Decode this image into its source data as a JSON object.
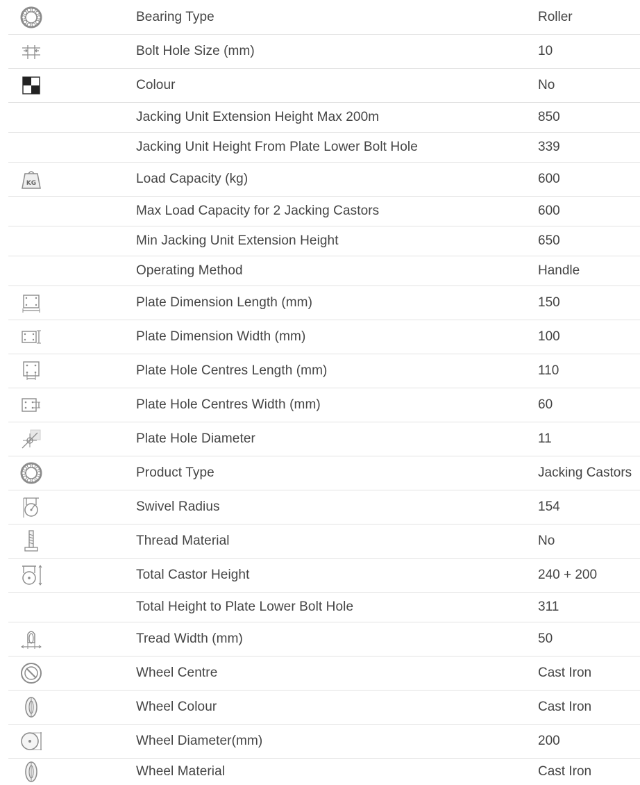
{
  "specs": [
    {
      "label": "Bearing Type",
      "value": "Roller",
      "icon": "bearing-icon"
    },
    {
      "label": "Bolt Hole Size (mm)",
      "value": "10",
      "icon": "bolt-hole-size-icon"
    },
    {
      "label": "Colour",
      "value": "No",
      "icon": "colour-icon"
    },
    {
      "label": "Jacking Unit Extension Height Max 200m",
      "value": "850",
      "icon": ""
    },
    {
      "label": "Jacking Unit Height From Plate Lower Bolt Hole",
      "value": "339",
      "icon": ""
    },
    {
      "label": "Load Capacity (kg)",
      "value": "600",
      "icon": "kg-weight-icon"
    },
    {
      "label": "Max Load Capacity for 2 Jacking Castors",
      "value": "600",
      "icon": ""
    },
    {
      "label": "Min Jacking Unit Extension Height",
      "value": "650",
      "icon": ""
    },
    {
      "label": "Operating Method",
      "value": "Handle",
      "icon": ""
    },
    {
      "label": "Plate Dimension Length (mm)",
      "value": "150",
      "icon": "plate-length-icon"
    },
    {
      "label": "Plate Dimension Width (mm)",
      "value": "100",
      "icon": "plate-width-icon"
    },
    {
      "label": "Plate Hole Centres Length (mm)",
      "value": "110",
      "icon": "plate-hole-centres-length-icon"
    },
    {
      "label": "Plate Hole Centres Width (mm)",
      "value": "60",
      "icon": "plate-hole-centres-width-icon"
    },
    {
      "label": "Plate Hole Diameter",
      "value": "11",
      "icon": "plate-hole-diameter-icon"
    },
    {
      "label": "Product Type",
      "value": "Jacking Castors",
      "icon": "product-type-icon"
    },
    {
      "label": "Swivel Radius",
      "value": "154",
      "icon": "swivel-radius-icon"
    },
    {
      "label": "Thread Material",
      "value": "No",
      "icon": "thread-icon"
    },
    {
      "label": "Total Castor Height",
      "value": "240 + 200",
      "icon": "castor-height-icon"
    },
    {
      "label": "Total Height to Plate Lower Bolt Hole",
      "value": "311",
      "icon": ""
    },
    {
      "label": "Tread Width (mm)",
      "value": "50",
      "icon": "tread-width-icon"
    },
    {
      "label": "Wheel Centre",
      "value": "Cast Iron",
      "icon": "wheel-centre-icon"
    },
    {
      "label": "Wheel Colour",
      "value": "Cast Iron",
      "icon": "wheel-colour-icon"
    },
    {
      "label": "Wheel Diameter(mm)",
      "value": "200",
      "icon": "wheel-diameter-icon"
    },
    {
      "label": "Wheel Material",
      "value": "Cast Iron",
      "icon": "wheel-material-icon"
    }
  ]
}
